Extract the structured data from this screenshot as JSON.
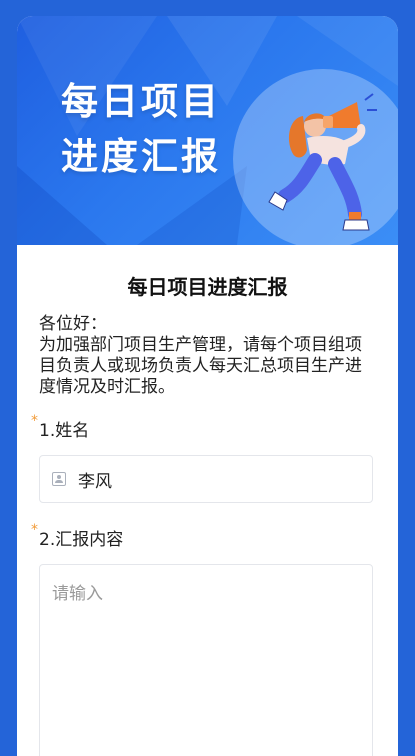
{
  "banner": {
    "title_line1": "每日项目",
    "title_line2": "进度汇报",
    "illustration": "megaphone-runner-illustration"
  },
  "form": {
    "title": "每日项目进度汇报",
    "intro": "各位好：\n为加强部门项目生产管理，请每个项目组项目负责人或现场负责人每天汇总项目生产进度情况及时汇报。",
    "questions": [
      {
        "required_mark": "*",
        "label": "1.姓名",
        "value": "李风",
        "icon": "user-icon"
      },
      {
        "required_mark": "*",
        "label": "2.汇报内容",
        "placeholder": "请输入"
      }
    ]
  },
  "colors": {
    "page_bg": "#2464d8",
    "banner": "#2b78ee",
    "required": "#f29b38",
    "placeholder": "#9a9a9a"
  }
}
